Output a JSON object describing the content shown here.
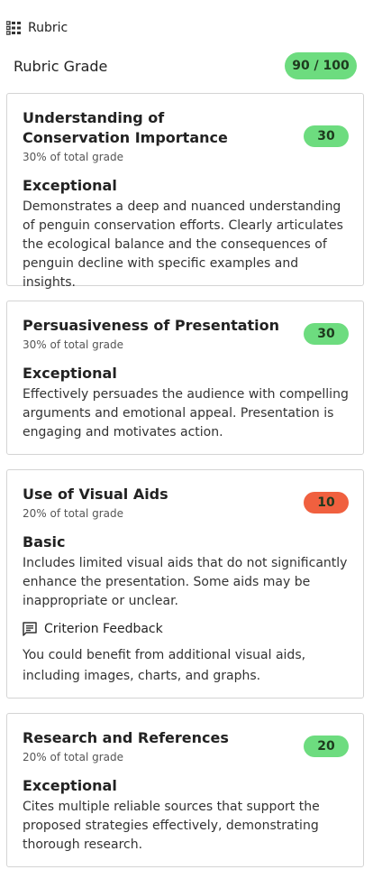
{
  "header": {
    "label": "Rubric"
  },
  "grade": {
    "title": "Rubric Grade",
    "total": "90 / 100"
  },
  "colors": {
    "good": "#6ddc7f",
    "bad": "#f0603f"
  },
  "criteria": [
    {
      "title": "Understanding of Conservation Importance",
      "weight": "30% of total grade",
      "score": "30",
      "level": "Exceptional",
      "description": "Demonstrates a deep and nuanced understanding of penguin conservation efforts. Clearly articulates the ecological balance and the consequences of penguin decline with specific examples and insights."
    },
    {
      "title": "Persuasiveness of Presentation",
      "weight": "30% of total grade",
      "score": "30",
      "level": "Exceptional",
      "description": "Effectively persuades the audience with compelling arguments and emotional appeal. Presentation is engaging and motivates action."
    },
    {
      "title": "Use of Visual Aids",
      "weight": "20% of total grade",
      "score": "10",
      "level": "Basic",
      "description": "Includes limited visual aids that do not significantly enhance the presentation. Some aids may be inappropriate or unclear.",
      "feedback_label": "Criterion Feedback",
      "feedback": "You could benefit from additional visual aids, including images, charts, and graphs."
    },
    {
      "title": "Research and References",
      "weight": "20% of total grade",
      "score": "20",
      "level": "Exceptional",
      "description": "Cites multiple reliable sources that support the proposed strategies effectively, demonstrating thorough research."
    }
  ]
}
